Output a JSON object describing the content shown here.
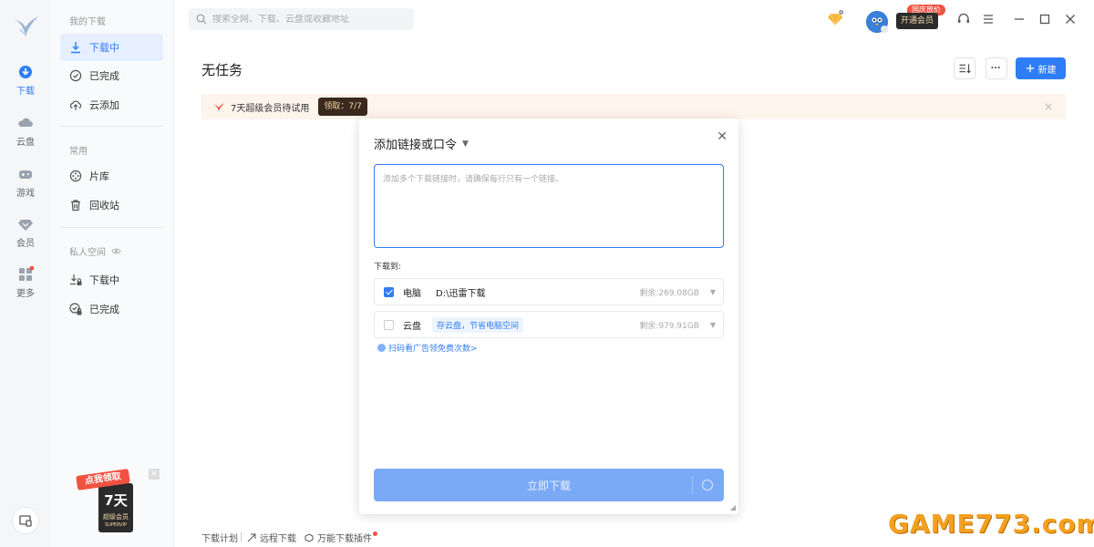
{
  "rail": {
    "items": [
      {
        "label": "下载",
        "icon": "download-icon",
        "active": true
      },
      {
        "label": "云盘",
        "icon": "cloud-icon"
      },
      {
        "label": "游戏",
        "icon": "gamepad-icon"
      },
      {
        "label": "会员",
        "icon": "diamond-icon"
      },
      {
        "label": "更多",
        "icon": "grid-icon"
      }
    ]
  },
  "sidebar": {
    "group_downloads": "我的下载",
    "downloading": "下载中",
    "completed": "已完成",
    "cloud_add": "云添加",
    "group_common": "常用",
    "library": "片库",
    "recycle": "回收站",
    "group_private": "私人空间",
    "private_downloading": "下载中",
    "private_completed": "已完成"
  },
  "search": {
    "placeholder": "搜索全网、下载、云盘或收藏地址"
  },
  "topbar": {
    "vip_badge": "国庆放价",
    "vip_button": "开通会员"
  },
  "main": {
    "title": "无任务",
    "new_button": "新建",
    "banner_text": "7天超级会员待试用",
    "banner_tag": "领取：7/7"
  },
  "footer": {
    "plan": "下载计划",
    "remote": "远程下载",
    "plugin": "万能下载插件"
  },
  "promo": {
    "line1": "点我领取",
    "line2": "7天",
    "line3": "超级会员",
    "line4": "SUPERVIP"
  },
  "dialog": {
    "title": "添加链接或口令",
    "textarea_placeholder": "添加多个下载链接时，请确保每行只有一个链接。",
    "save_to_label": "下载到:",
    "pc": {
      "name": "电脑",
      "path": "D:\\迅雷下载",
      "space": "剩余:269.08GB",
      "checked": true
    },
    "cloud": {
      "name": "云盘",
      "hint": "存云盘，节省电脑空间",
      "space": "剩余:979.91GB",
      "checked": false
    },
    "scan_link": "扫码看广告领免费次数>",
    "download_button": "立即下载"
  },
  "watermark": "GAME773.com",
  "colors": {
    "accent": "#2f7df6",
    "banner_bg": "#fdf4ec",
    "promo_red": "#f25141"
  }
}
